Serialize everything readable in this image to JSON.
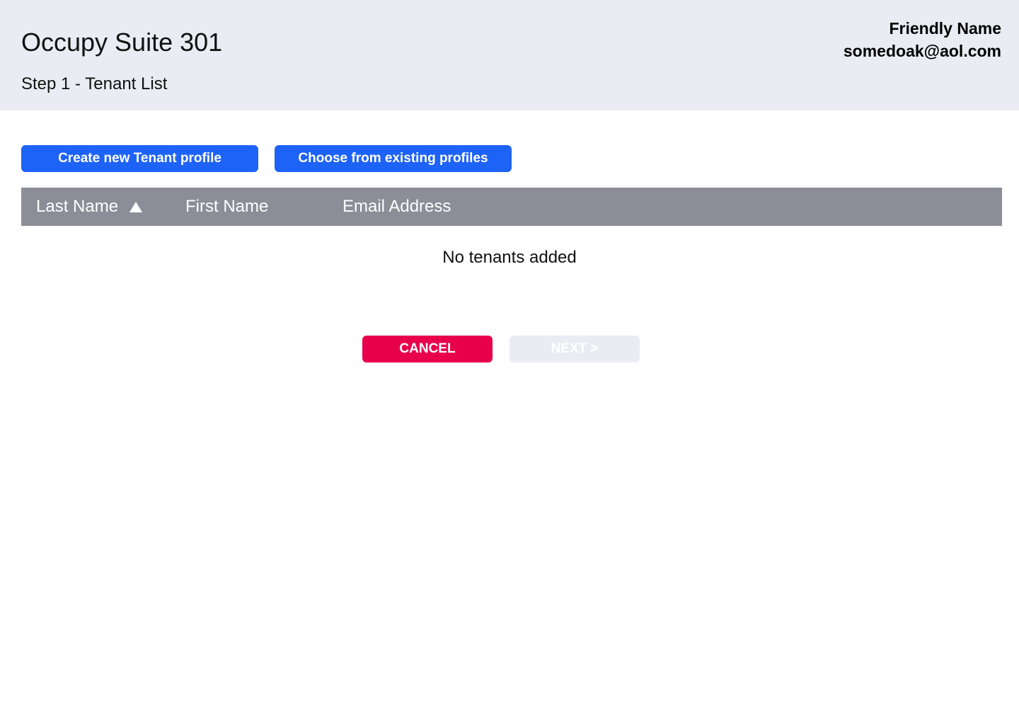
{
  "header": {
    "title": "Occupy Suite 301",
    "step": "Step 1 - Tenant List",
    "user_name": "Friendly Name",
    "user_email": "somedoak@aol.com"
  },
  "actions": {
    "create_label": "Create new Tenant profile",
    "choose_label": "Choose from existing profiles"
  },
  "table": {
    "columns": [
      {
        "label": "Last Name",
        "sorted": "ascending"
      },
      {
        "label": "First Name"
      },
      {
        "label": "Email Address"
      }
    ],
    "rows": [],
    "empty_message": "No tenants added"
  },
  "footer": {
    "cancel_label": "CANCEL",
    "next_label": "NEXT >",
    "next_enabled": false
  },
  "colors": {
    "header_bg": "#ebecf3",
    "primary": "#1e63f7",
    "table_header": "#8d8d98",
    "cancel": "#e8004c",
    "disabled": "#ebecf3"
  },
  "icons": {
    "sort": "sort-ascending-icon"
  }
}
